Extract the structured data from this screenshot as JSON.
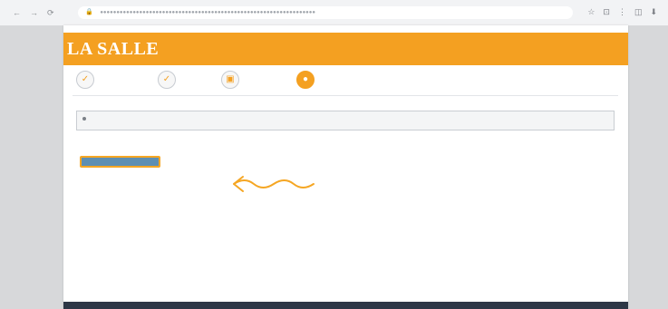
{
  "browser": {
    "nav_back": "←",
    "nav_forward": "→",
    "nav_reload": "⟳",
    "lock_icon": "🔒",
    "url": "●●●●●●●●●●●●●●●●●●●●●●●●●●●●●●●●●●●●●●●●●●●●●●●●●●●●●●●●●●●●●●●●●●",
    "toolbar": [
      "☆",
      "⊡",
      "⋮",
      "◫",
      "⬇"
    ]
  },
  "header": {
    "brand": "LA SALLE",
    "subtitle": "",
    "subtitle2": "",
    "accent_color": "#f4a021"
  },
  "steps": [
    {
      "icon": "✓",
      "label": "",
      "active": false
    },
    {
      "icon": "✓",
      "label": "",
      "active": false
    },
    {
      "icon": "▣",
      "label": "",
      "active": false
    },
    {
      "icon": "●",
      "label": "",
      "active": true
    }
  ],
  "content": {
    "section_title": "",
    "info_text": ""
  },
  "actions": {
    "continue_label": ""
  },
  "annotation": {
    "arrow_color": "#f5a623"
  }
}
